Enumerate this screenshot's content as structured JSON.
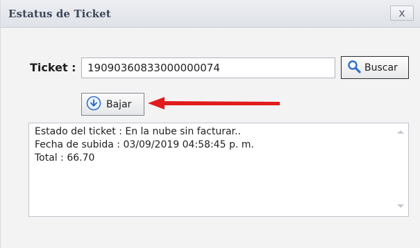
{
  "window": {
    "title": "Estatus de Ticket",
    "close_label": "x"
  },
  "form": {
    "ticket_label": "Ticket :",
    "ticket_value": "19090360833000000074",
    "buscar_label": "Buscar",
    "bajar_label": "Bajar"
  },
  "status": {
    "lines": [
      "Estado del ticket : En la nube sin facturar..",
      "Fecha de subida : 03/09/2019 04:58:45 p. m.",
      "Total : 66.70"
    ]
  },
  "icons": {
    "search": "search-icon",
    "download": "download-circle-icon",
    "arrow": "red-arrow-icon"
  },
  "colors": {
    "accent_blue": "#2f6fc8",
    "annotation_red": "#e11c1c"
  }
}
